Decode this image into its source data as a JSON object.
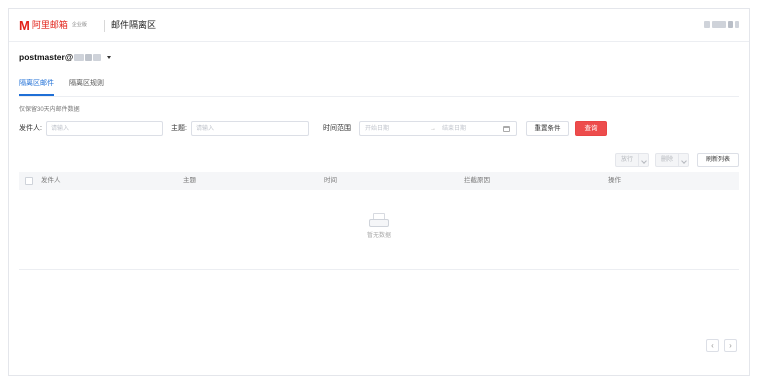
{
  "header": {
    "logo_mark": "M",
    "logo_text": "阿里邮箱",
    "logo_sub": "企业版",
    "title": "邮件隔离区"
  },
  "account": {
    "name": "postmaster@"
  },
  "tabs": [
    {
      "label": "隔离区邮件",
      "active": true
    },
    {
      "label": "隔离区规则",
      "active": false
    }
  ],
  "hint": "仅保留30天内邮件数据",
  "filters": {
    "sender_label": "发件人:",
    "sender_placeholder": "请输入",
    "subject_label": "主题:",
    "subject_placeholder": "请输入",
    "time_label": "时间范围",
    "start_placeholder": "开始日期",
    "separator": "→",
    "end_placeholder": "结束日期",
    "reset_label": "重置条件",
    "search_label": "查询"
  },
  "actions": {
    "release_label": "放行",
    "delete_label": "删除",
    "refresh_label": "刷新列表"
  },
  "table": {
    "columns": [
      "发件人",
      "主题",
      "时间",
      "拦截原因",
      "操作"
    ],
    "empty_text": "暂无数据"
  },
  "pager": {
    "prev": "‹",
    "next": "›"
  },
  "colors": {
    "brand": "#e2231a",
    "accent": "#1f6fd6",
    "search_button": "#ed4c4c"
  }
}
